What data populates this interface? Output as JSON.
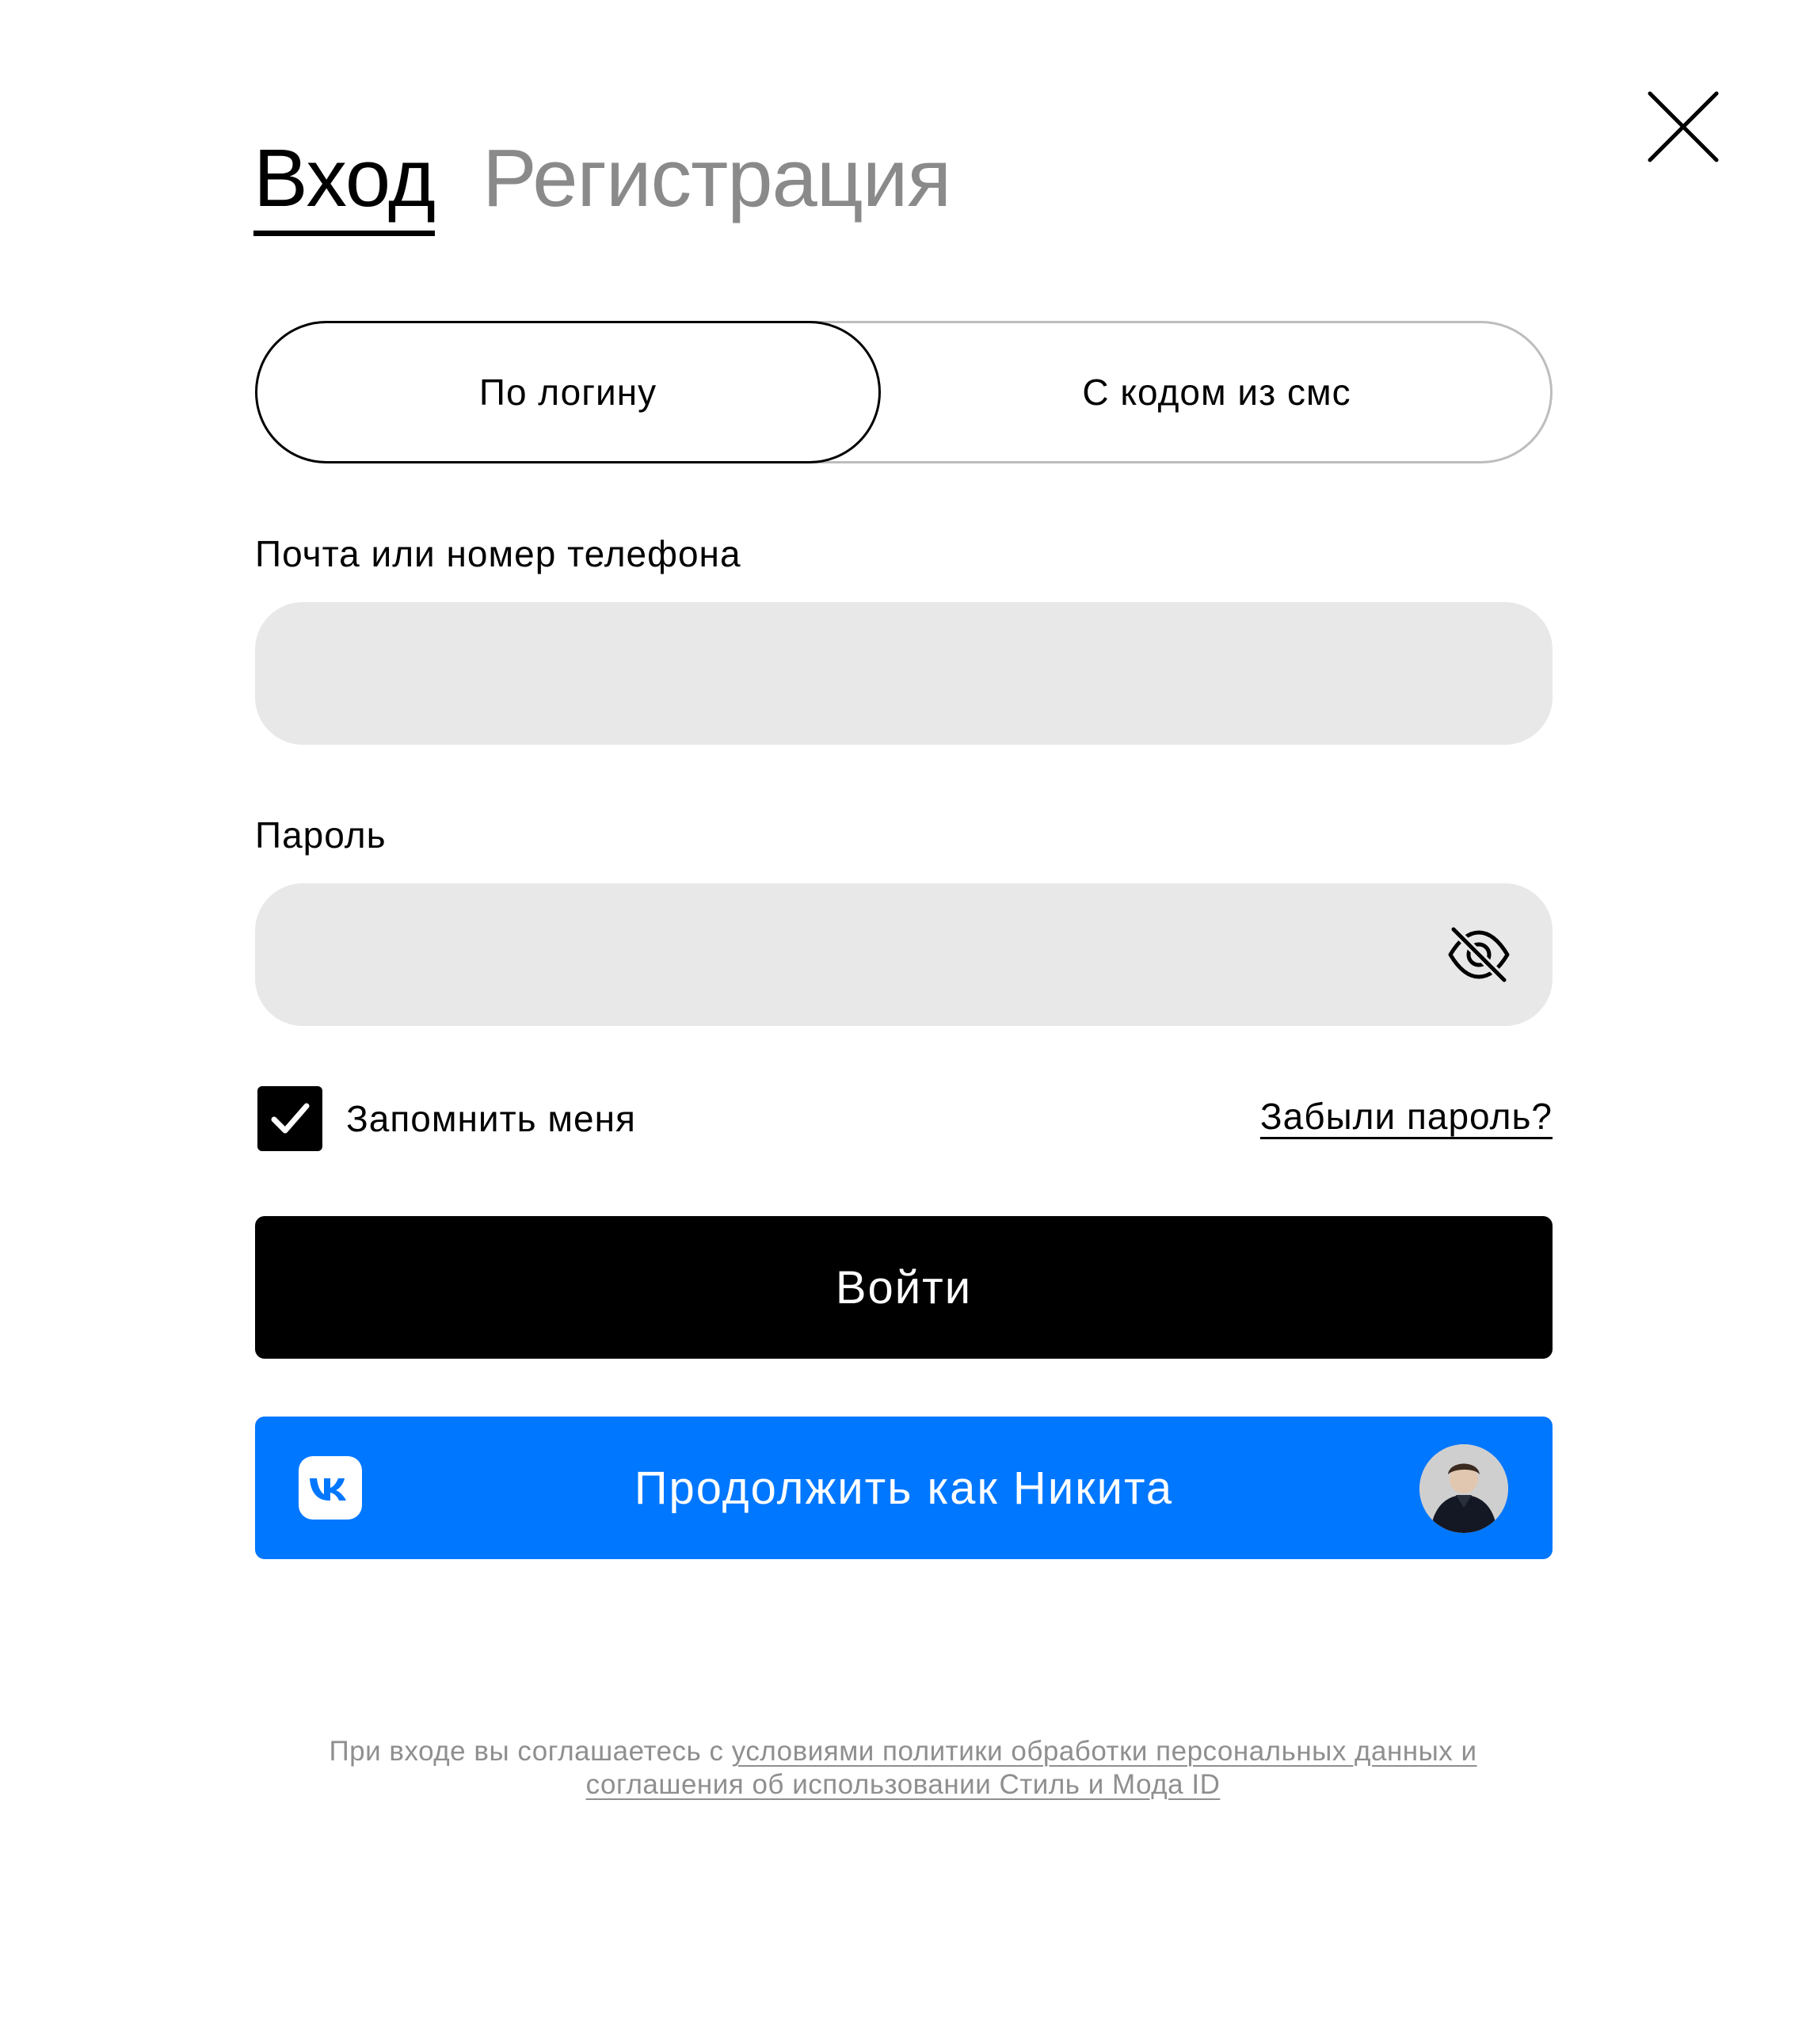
{
  "header": {
    "tab_login": "Вход",
    "tab_register": "Регистрация",
    "active_tab": "login"
  },
  "login_method": {
    "by_login": "По логину",
    "by_sms": "С кодом из смс",
    "active": "by_login"
  },
  "form": {
    "email_label": "Почта или номер телефона",
    "email_value": "",
    "email_placeholder": "",
    "password_label": "Пароль",
    "password_value": "",
    "password_placeholder": "",
    "remember_label": "Запомнить меня",
    "remember_checked": true,
    "forgot_link": "Забыли пароль?",
    "submit_label": "Войти"
  },
  "vk_button": {
    "label": "Продолжить как Никита"
  },
  "footer": {
    "prefix": "При входе вы соглашаетесь с ",
    "link_text": "условиями политики обработки персональных данных и соглашения об использовании Стиль и Мода ID"
  },
  "icons": {
    "close": "close-icon",
    "eye_toggle": "eye-off-icon",
    "checkbox": "checkmark-icon",
    "vk": "vk-logo-icon",
    "avatar": "avatar"
  },
  "colors": {
    "primary": "#000000",
    "inactive_tab": "#8a8a8a",
    "input_bg": "#e8e8e8",
    "vk_blue": "#0077ff",
    "footer_text": "#8f8f8f"
  }
}
